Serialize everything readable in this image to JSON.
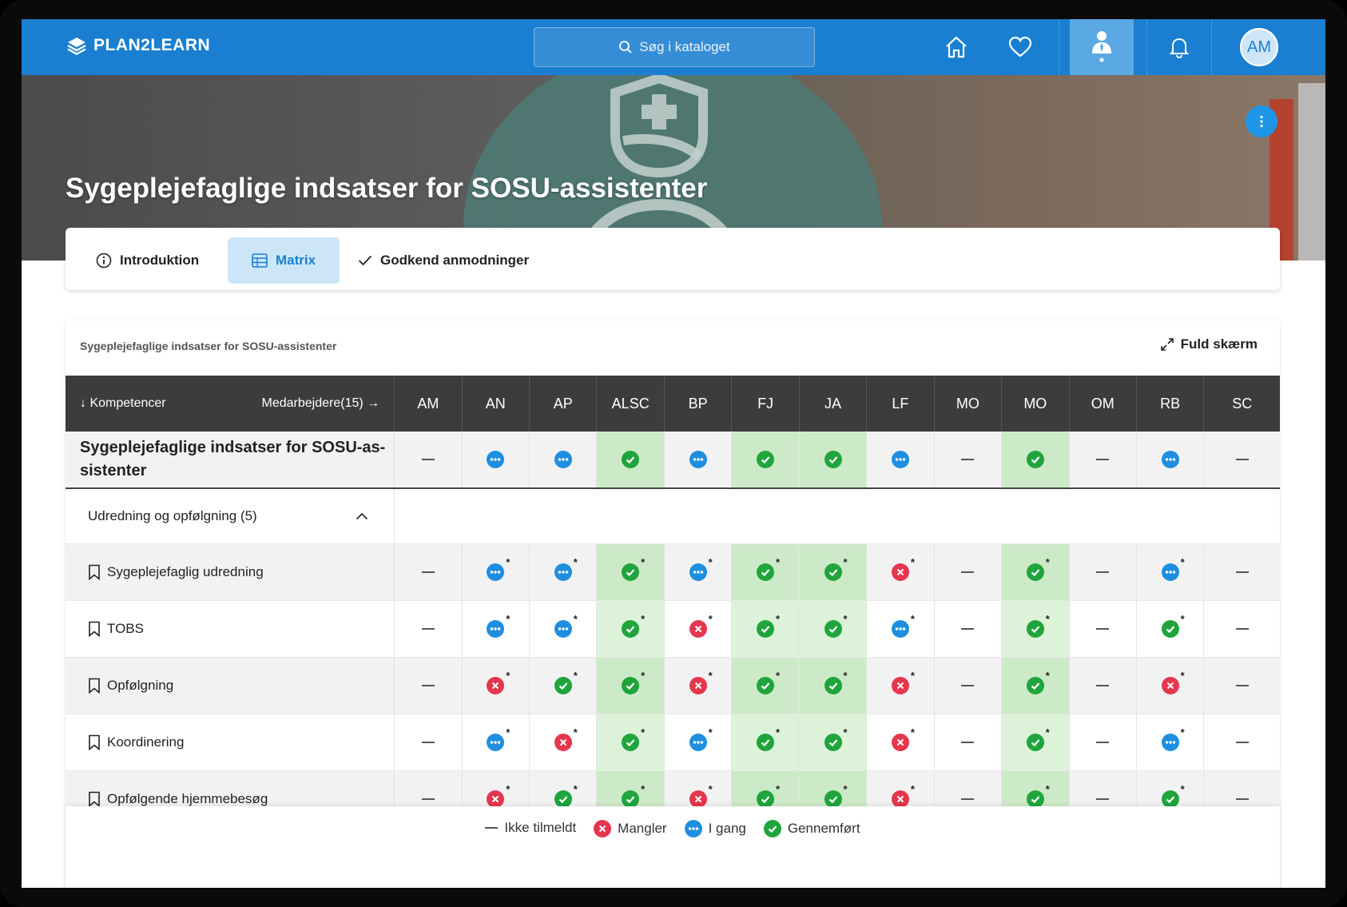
{
  "app": {
    "logo_text": "PLAN2LEARN"
  },
  "search": {
    "placeholder": "Søg i kataloget"
  },
  "user": {
    "initials": "AM"
  },
  "hero": {
    "title": "Sygeplejefaglige indsatser for SOSU-assistenter"
  },
  "tabs": [
    {
      "label": "Introduktion",
      "icon": "info-icon"
    },
    {
      "label": "Matrix",
      "icon": "table-icon"
    },
    {
      "label": "Godkend anmodninger",
      "icon": "check-icon"
    }
  ],
  "matrix": {
    "title": "Sygeplejefaglige indsatser for SOSU-assistenter",
    "fullscreen_label": "Fuld skærm",
    "header_left": "↓ Kompetencer",
    "header_right": "Medarbejdere(15) →",
    "columns": [
      "AM",
      "AN",
      "AP",
      "ALSC",
      "BP",
      "FJ",
      "JA",
      "LF",
      "MO",
      "MO",
      "OM",
      "RB",
      "SC"
    ],
    "green_columns": [
      3,
      5,
      6,
      9
    ],
    "summary": {
      "label": "Sygeplejefaglige indsatser for SOSU-as-sistenter",
      "statuses": [
        "none",
        "progress",
        "progress",
        "done",
        "progress",
        "done",
        "done",
        "progress",
        "none",
        "done",
        "none",
        "progress",
        "none"
      ]
    },
    "group": {
      "label": "Udredning og opfølgning (5)"
    },
    "rows": [
      {
        "label": "Sygeplejefaglig udredning",
        "statuses": [
          "none",
          "progress",
          "progress",
          "done",
          "progress",
          "done",
          "done",
          "missing",
          "none",
          "done",
          "none",
          "progress",
          "none"
        ]
      },
      {
        "label": "TOBS",
        "statuses": [
          "none",
          "progress",
          "progress",
          "done",
          "missing",
          "done",
          "done",
          "progress",
          "none",
          "done",
          "none",
          "done",
          "none"
        ]
      },
      {
        "label": "Opfølgning",
        "statuses": [
          "none",
          "missing",
          "done",
          "done",
          "missing",
          "done",
          "done",
          "missing",
          "none",
          "done",
          "none",
          "missing",
          "none"
        ]
      },
      {
        "label": "Koordinering",
        "statuses": [
          "none",
          "progress",
          "missing",
          "done",
          "progress",
          "done",
          "done",
          "missing",
          "none",
          "done",
          "none",
          "progress",
          "none"
        ]
      },
      {
        "label": "Opfølgende hjemmebesøg",
        "statuses": [
          "none",
          "missing",
          "done",
          "done",
          "missing",
          "done",
          "done",
          "missing",
          "none",
          "done",
          "none",
          "done",
          "none"
        ]
      }
    ]
  },
  "legend": {
    "not_enrolled": "Ikke tilmeldt",
    "missing": "Mangler",
    "in_progress": "I gang",
    "completed": "Gennemført"
  },
  "colors": {
    "brand": "#1a7fd0",
    "done": "#1fa53c",
    "progress": "#1e8fe0",
    "missing": "#e5364e",
    "green_col": "#cdeac8"
  }
}
